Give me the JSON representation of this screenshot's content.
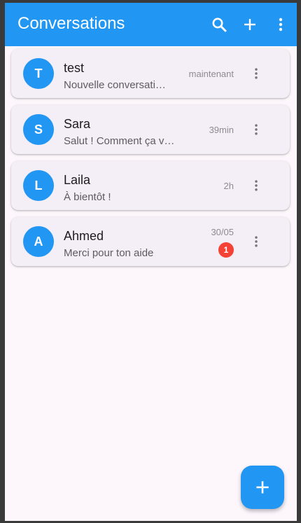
{
  "colors": {
    "primary": "#2196f3",
    "badge": "#f44336",
    "background": "#fdf7fc",
    "card": "#f4eff6"
  },
  "appbar": {
    "title": "Conversations",
    "actions": [
      "search-icon",
      "add-icon",
      "more-vert-icon"
    ]
  },
  "conversations": [
    {
      "initial": "T",
      "name": "test",
      "last_message": "Nouvelle conversati…",
      "time": "maintenant",
      "unread": ""
    },
    {
      "initial": "S",
      "name": "Sara",
      "last_message": "Salut ! Comment ça va ?",
      "time": "39min",
      "unread": ""
    },
    {
      "initial": "L",
      "name": "Laila",
      "last_message": "À bientôt !",
      "time": "2h",
      "unread": ""
    },
    {
      "initial": "A",
      "name": "Ahmed",
      "last_message": "Merci pour ton aide",
      "time": "30/05",
      "unread": "1"
    }
  ],
  "fab": {
    "icon": "add-icon"
  }
}
